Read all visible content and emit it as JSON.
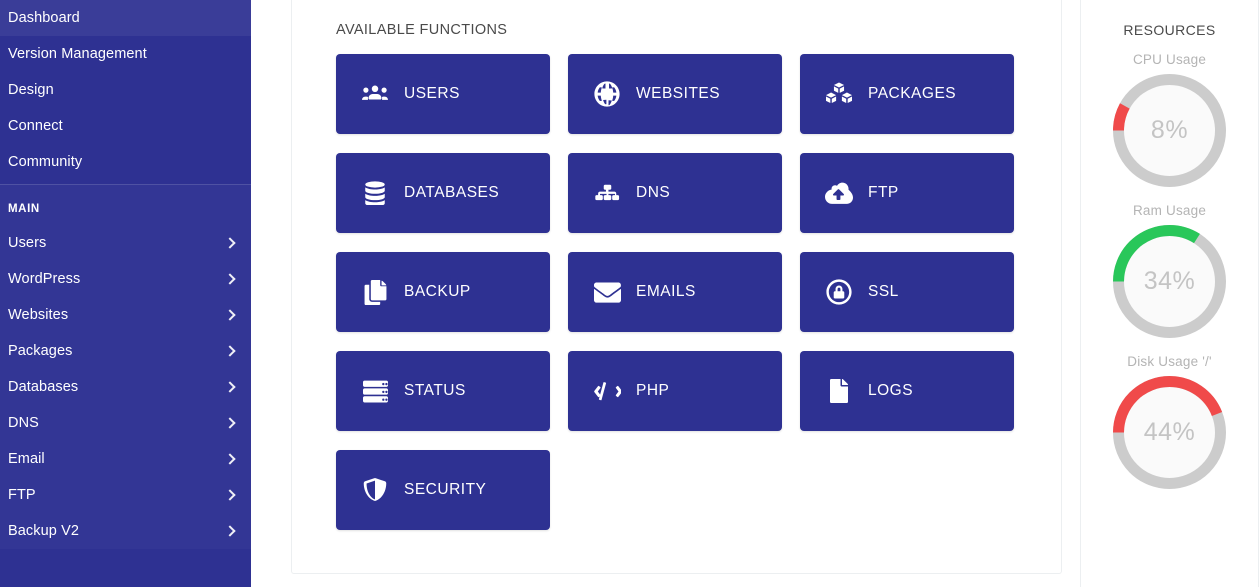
{
  "sidebar": {
    "top_items": [
      {
        "label": "Dashboard",
        "chevron": false
      },
      {
        "label": "Version Management",
        "chevron": false
      },
      {
        "label": "Design",
        "chevron": false
      },
      {
        "label": "Connect",
        "chevron": false
      },
      {
        "label": "Community",
        "chevron": false
      }
    ],
    "group_title": "MAIN",
    "main_items": [
      {
        "label": "Users",
        "chevron": true
      },
      {
        "label": "WordPress",
        "chevron": true
      },
      {
        "label": "Websites",
        "chevron": true
      },
      {
        "label": "Packages",
        "chevron": true
      },
      {
        "label": "Databases",
        "chevron": true
      },
      {
        "label": "DNS",
        "chevron": true
      },
      {
        "label": "Email",
        "chevron": true
      },
      {
        "label": "FTP",
        "chevron": true
      },
      {
        "label": "Backup V2",
        "chevron": true
      }
    ],
    "bg_color": "#2e3192"
  },
  "main": {
    "title": "AVAILABLE FUNCTIONS",
    "card_color": "#2e3192",
    "functions": [
      {
        "label": "USERS",
        "icon": "users-icon"
      },
      {
        "label": "WEBSITES",
        "icon": "globe-icon"
      },
      {
        "label": "PACKAGES",
        "icon": "boxes-icon"
      },
      {
        "label": "DATABASES",
        "icon": "database-icon"
      },
      {
        "label": "DNS",
        "icon": "sitemap-icon"
      },
      {
        "label": "FTP",
        "icon": "cloud-upload-icon"
      },
      {
        "label": "BACKUP",
        "icon": "copy-icon"
      },
      {
        "label": "EMAILS",
        "icon": "envelope-icon"
      },
      {
        "label": "SSL",
        "icon": "lock-circle-icon"
      },
      {
        "label": "STATUS",
        "icon": "server-icon"
      },
      {
        "label": "PHP",
        "icon": "code-icon"
      },
      {
        "label": "LOGS",
        "icon": "file-icon"
      },
      {
        "label": "SECURITY",
        "icon": "shield-icon"
      }
    ]
  },
  "resources": {
    "title": "RESOURCES",
    "gauges": [
      {
        "label": "CPU Usage",
        "value": 8,
        "display": "8%",
        "color": "#f04a4a"
      },
      {
        "label": "Ram Usage",
        "value": 34,
        "display": "34%",
        "color": "#29c75a"
      },
      {
        "label": "Disk Usage '/'",
        "value": 44,
        "display": "44%",
        "color": "#f04a4a"
      }
    ],
    "track_color": "#cccccc"
  }
}
